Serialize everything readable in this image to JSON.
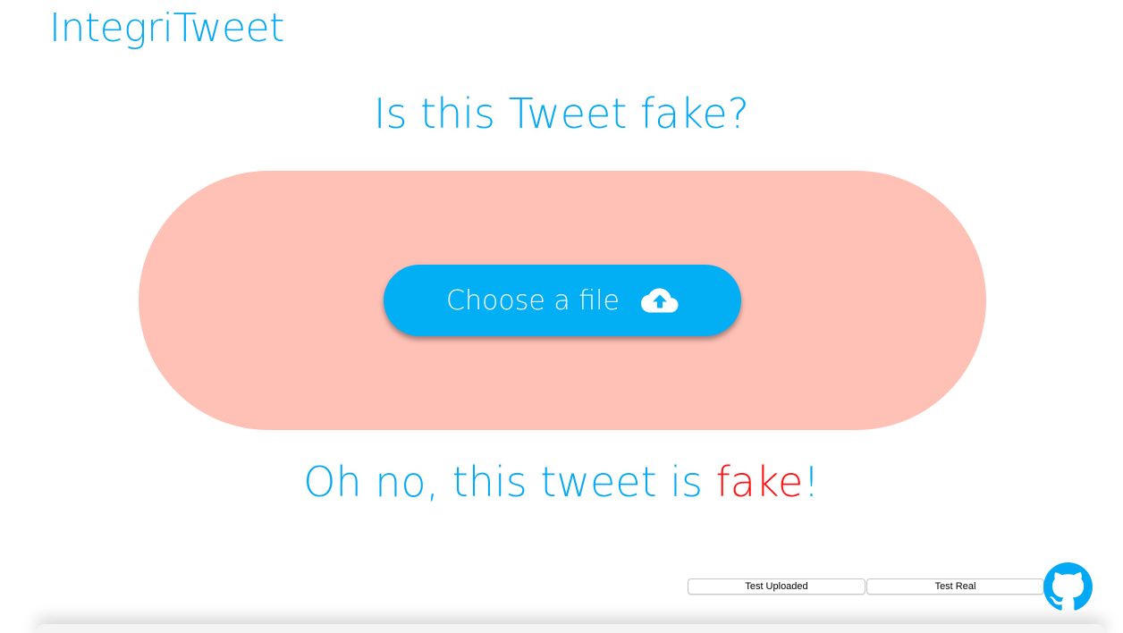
{
  "app": {
    "title": "IntegriTweet"
  },
  "main": {
    "question": "Is this Tweet fake?",
    "upload": {
      "label": "Choose a file",
      "icon": "cloud-upload-icon"
    },
    "result": {
      "prefix": "Oh no, this tweet is ",
      "verdict": "fake",
      "suffix": "!"
    }
  },
  "footer": {
    "test_uploaded_label": "Test Uploaded",
    "test_real_label": "Test Real",
    "github_icon": "github-icon"
  },
  "colors": {
    "accent": "#03a9f4",
    "drop_zone": "#ffc0b6",
    "fake": "#ff1111"
  }
}
